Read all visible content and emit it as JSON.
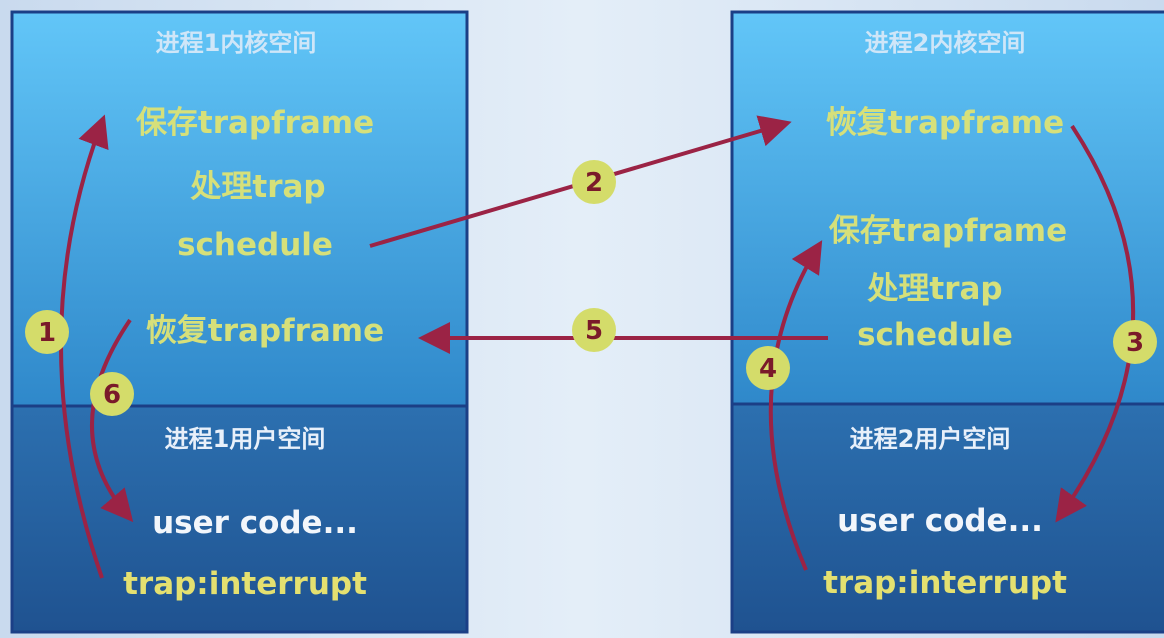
{
  "colors": {
    "arrow": "#9b2345",
    "badge": "#d4dc6a",
    "kernel_text": "#d6e07a",
    "user_text": "#f2f6fb"
  },
  "process1": {
    "kernel_title": "进程1内核空间",
    "kernel_items": [
      "保存trapframe",
      "处理trap",
      "schedule",
      "恢复trapframe"
    ],
    "user_title": "进程1用户空间",
    "user_items": [
      "user code...",
      "trap:interrupt"
    ]
  },
  "process2": {
    "kernel_title": "进程2内核空间",
    "kernel_items": [
      "恢复trapframe",
      "保存trapframe",
      "处理trap",
      "schedule"
    ],
    "user_title": "进程2用户空间",
    "user_items": [
      "user code...",
      "trap:interrupt"
    ]
  },
  "steps": [
    "1",
    "2",
    "3",
    "4",
    "5",
    "6"
  ]
}
